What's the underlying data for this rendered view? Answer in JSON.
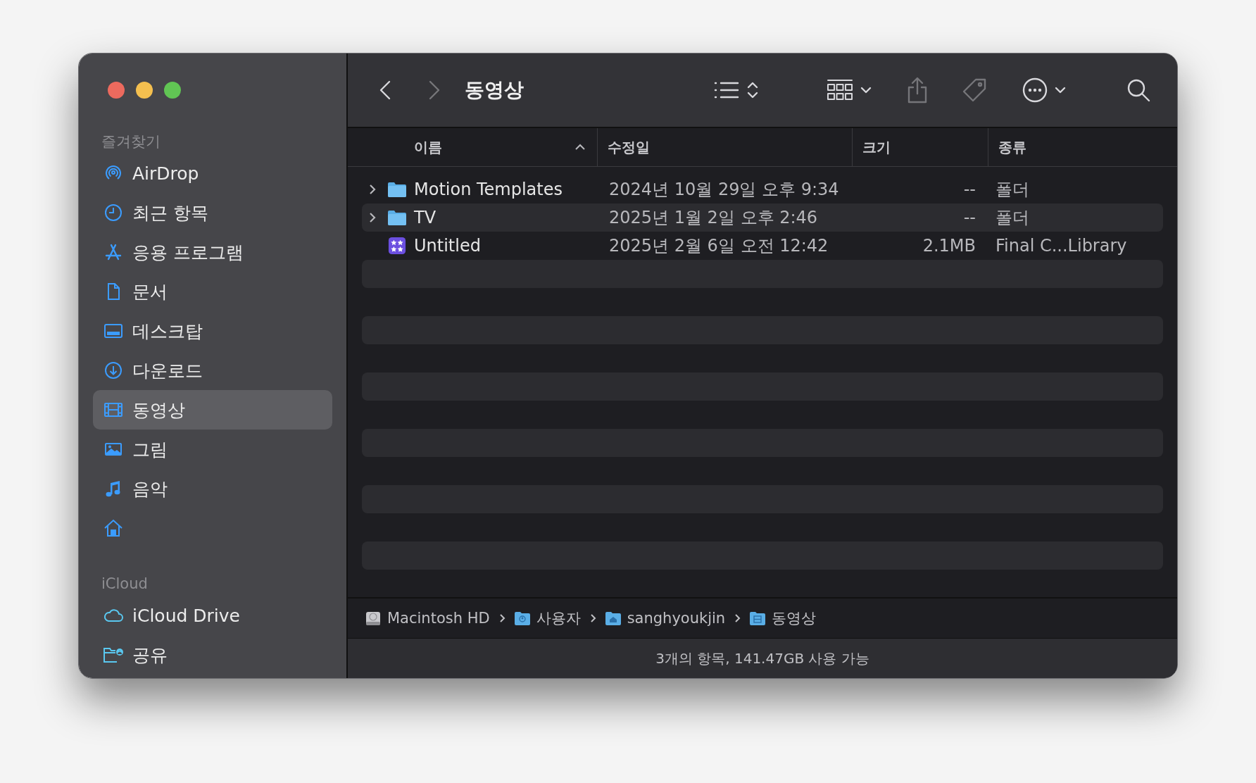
{
  "window": {
    "title": "동영상"
  },
  "sidebar": {
    "sections": [
      {
        "heading": "즐겨찾기",
        "items": [
          {
            "label": "AirDrop",
            "selected": false
          },
          {
            "label": "최근 항목",
            "selected": false
          },
          {
            "label": "응용 프로그램",
            "selected": false
          },
          {
            "label": "문서",
            "selected": false
          },
          {
            "label": "데스크탑",
            "selected": false
          },
          {
            "label": "다운로드",
            "selected": false
          },
          {
            "label": "동영상",
            "selected": true
          },
          {
            "label": "그림",
            "selected": false
          },
          {
            "label": "음악",
            "selected": false
          },
          {
            "selected": false
          }
        ]
      },
      {
        "heading": "iCloud",
        "items": [
          {
            "label": "iCloud Drive",
            "selected": false
          },
          {
            "label": "공유",
            "selected": false
          }
        ]
      }
    ]
  },
  "table": {
    "columns": [
      {
        "label": "이름",
        "sorted": true
      },
      {
        "label": "수정일",
        "sorted": false
      },
      {
        "label": "크기",
        "sorted": false
      },
      {
        "label": "종류",
        "sorted": false
      }
    ],
    "rows": [
      {
        "kind": "folder",
        "name": "Motion Templates",
        "date_modified": "2024년 10월 29일 오후 9:34",
        "size": "--",
        "type": "폴더",
        "expandable": true
      },
      {
        "kind": "folder",
        "name": "TV",
        "date_modified": "2025년 1월 2일 오후 2:46",
        "size": "--",
        "type": "폴더",
        "expandable": true
      },
      {
        "kind": "library",
        "name": "Untitled",
        "date_modified": "2025년 2월 6일 오전 12:42",
        "size": "2.1MB",
        "type": "Final C...Library",
        "expandable": false
      }
    ]
  },
  "path_bar": [
    {
      "kind": "disk",
      "label": "Macintosh HD"
    },
    {
      "kind": "users",
      "label": "사용자"
    },
    {
      "kind": "home",
      "label": "sanghyoukjin"
    },
    {
      "kind": "movies",
      "label": "동영상"
    }
  ],
  "status_bar": "3개의 항목, 141.47GB 사용 가능"
}
